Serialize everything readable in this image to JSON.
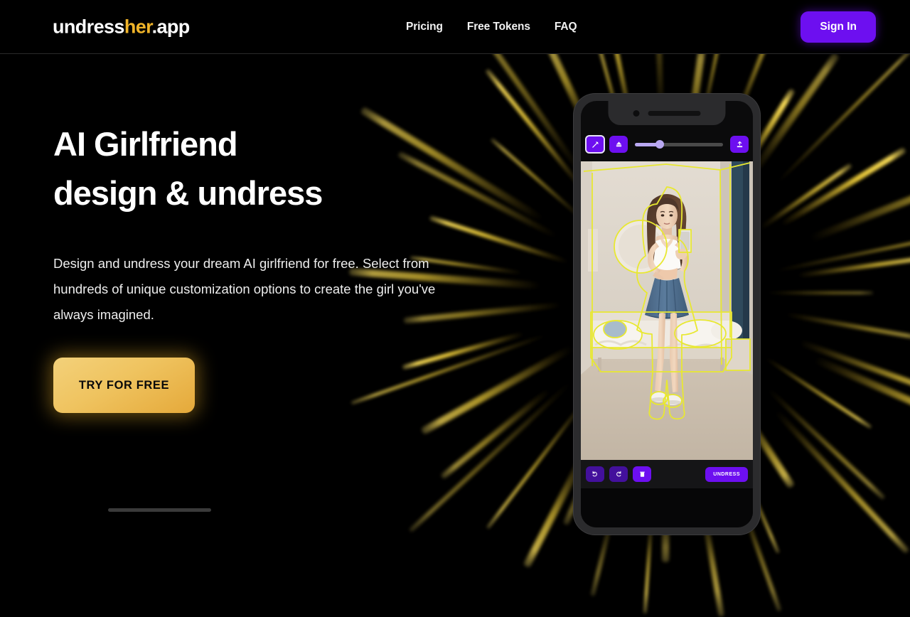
{
  "site": {
    "background": "#000000",
    "accent_gold": "#f0b429",
    "accent_purple": "#6d0ff0"
  },
  "header": {
    "logo": {
      "part1": "undress",
      "part2": "her",
      "part3": ".app"
    },
    "nav": [
      {
        "label": "Pricing"
      },
      {
        "label": "Free Tokens"
      },
      {
        "label": "FAQ"
      }
    ],
    "signin_label": "Sign In"
  },
  "hero": {
    "headline_line1": "AI Girlfriend",
    "headline_line2": "design & undress",
    "subcopy": "Design and undress your dream AI girlfriend for free. Select from hundreds of unique customization options to create the girl you've always imagined.",
    "cta_label": "TRY FOR FREE"
  },
  "phone": {
    "toolbar_top": {
      "brush_icon": "brush-icon",
      "eraser_icon": "eraser-icon",
      "upload_icon": "upload-icon",
      "brush_size_percent": 28
    },
    "toolbar_bottom": {
      "undo_icon": "undo-icon",
      "redo_icon": "redo-icon",
      "trash_icon": "trash-icon",
      "undress_label": "UNDRESS"
    },
    "photo": {
      "description": "Mirror selfie of a woman in a bedroom with yellow AI segmentation outlines",
      "segmentation_color": "#e8e831",
      "subject": {
        "top": "white crop tank top",
        "skirt": "blue pleated skirt",
        "shoes": "white sneakers",
        "hair": "long brown hair"
      },
      "room": {
        "bed": "white bedding",
        "floor": "beige carpet",
        "curtain": "dark teal curtain",
        "wall": "beige wall"
      }
    }
  },
  "decor": {
    "starburst_color": "#f5d43c",
    "ray_count": 46
  }
}
